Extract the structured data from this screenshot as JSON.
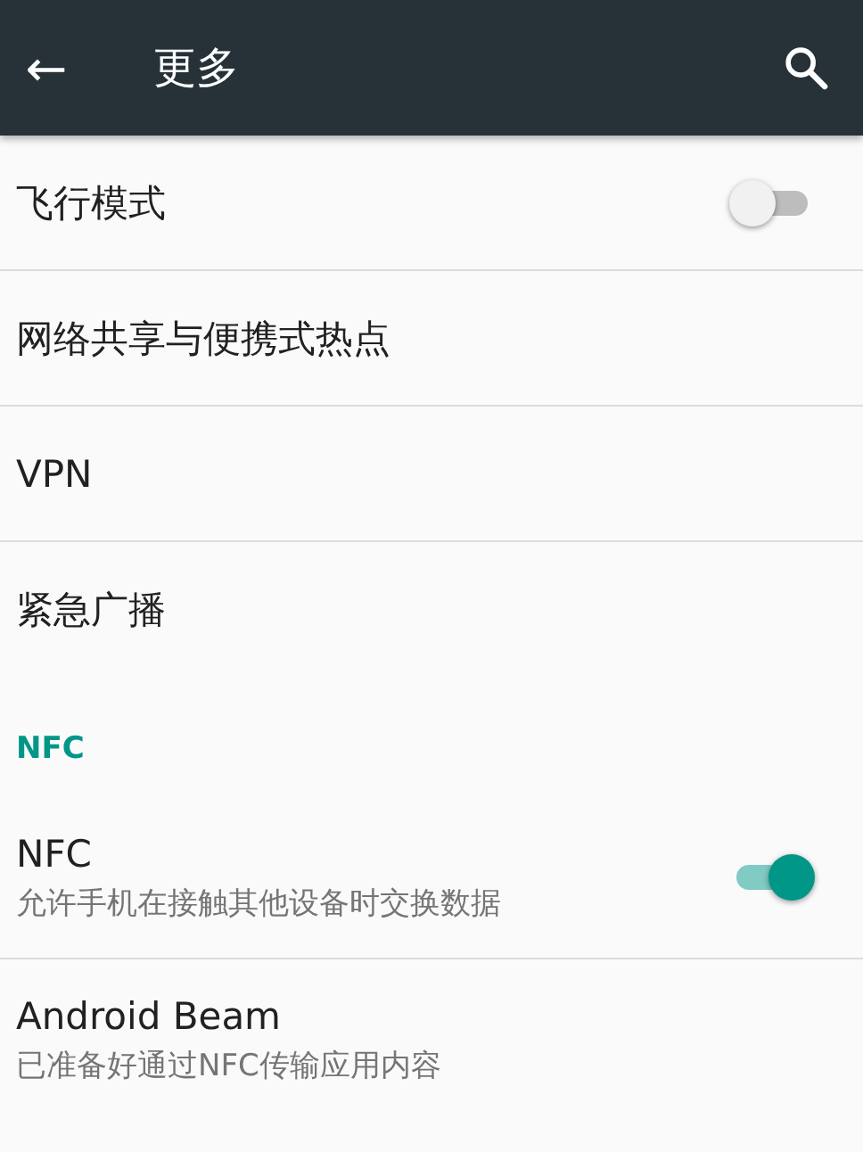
{
  "toolbar": {
    "back_icon": "←",
    "title": "更多"
  },
  "sections": [
    {
      "items": [
        {
          "kind": "switch",
          "title": "飞行模式",
          "on": false
        },
        {
          "kind": "plain",
          "title": "网络共享与便携式热点"
        },
        {
          "kind": "plain",
          "title": "VPN"
        },
        {
          "kind": "plain",
          "title": "紧急广播"
        }
      ]
    },
    {
      "header": "NFC",
      "items": [
        {
          "kind": "switch",
          "title": "NFC",
          "summary": "允许手机在接触其他设备时交换数据",
          "on": true
        },
        {
          "kind": "plain",
          "title": "Android Beam",
          "summary": "已准备好通过NFC传输应用内容"
        }
      ]
    }
  ]
}
